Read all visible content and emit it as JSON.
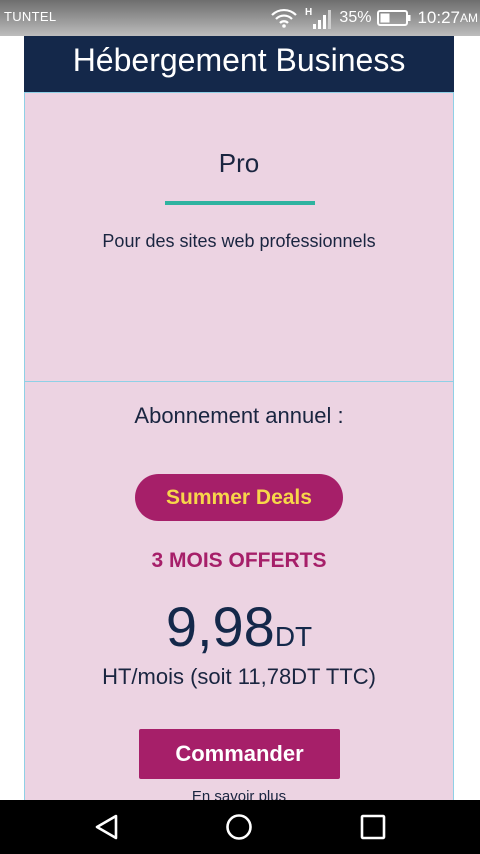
{
  "status_bar": {
    "carrier": "TUNTEL",
    "network_type": "H",
    "battery_percent": "35%",
    "time": "10:27",
    "ampm": "AM"
  },
  "card": {
    "header_title": "Hébergement Business",
    "plan_name": "Pro",
    "plan_description": "Pour des sites web professionnels",
    "subscription_label": "Abonnement annuel :",
    "badge_label": "Summer Deals",
    "offer_text": "3 MOIS OFFERTS",
    "price_amount": "9,98",
    "price_currency": "DT",
    "price_period": "HT/mois (soit 11,78DT TTC)",
    "order_button_label": "Commander",
    "more_link_label": "En savoir plus"
  },
  "icons": {
    "wifi": "wifi-icon",
    "signal": "signal-icon",
    "battery": "battery-icon",
    "back": "back-icon",
    "home": "home-icon",
    "recents": "recents-icon"
  },
  "colors": {
    "header_bg": "#14284a",
    "card_bg": "#ecd3e2",
    "accent_magenta": "#a61f69",
    "badge_text": "#f7d64a",
    "divider_teal": "#2fb3a0"
  }
}
